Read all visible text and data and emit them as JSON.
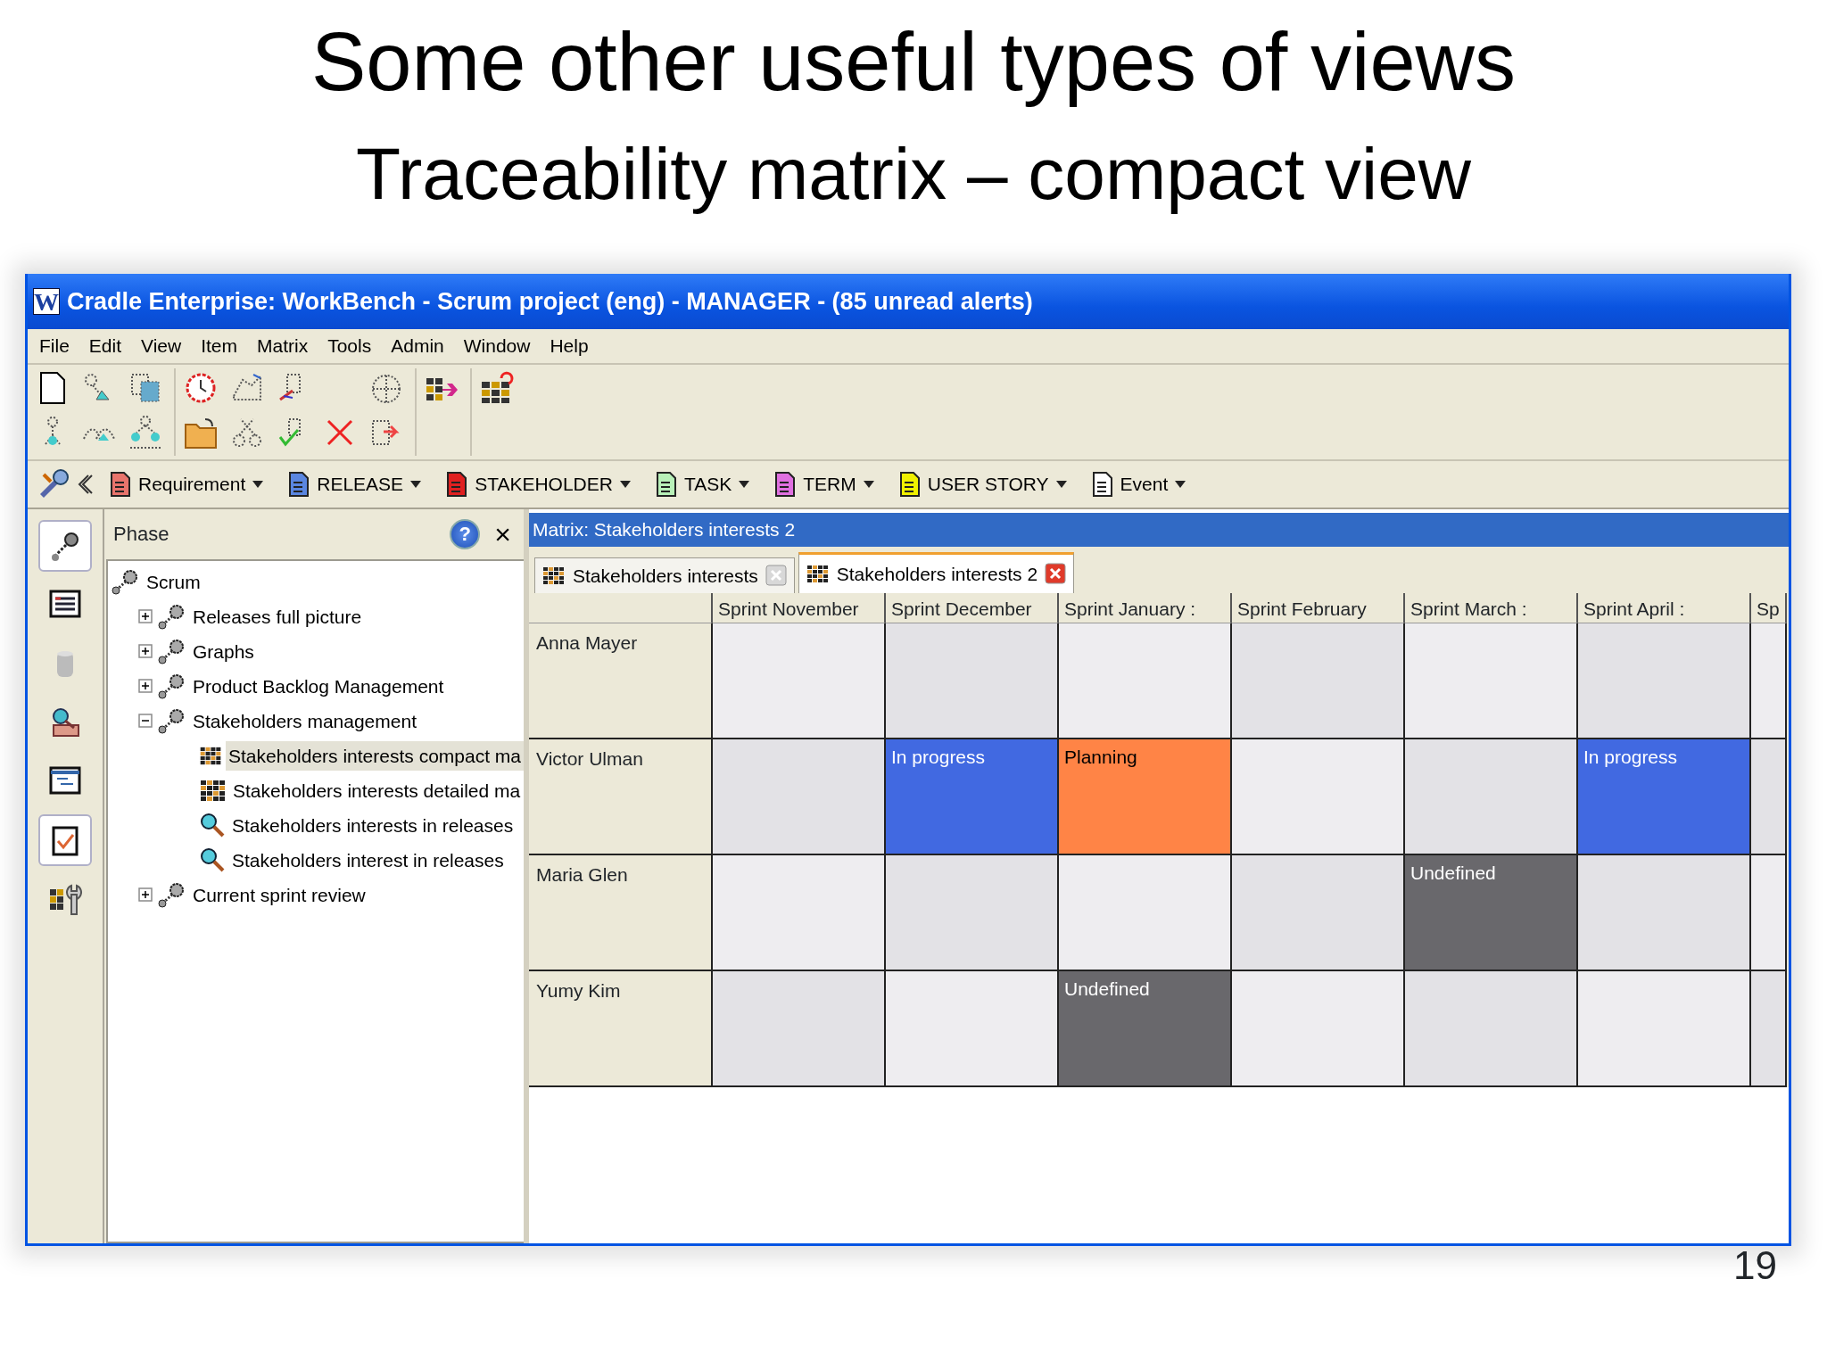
{
  "slide": {
    "title": "Some other useful types of views",
    "subtitle": "Traceability matrix – compact view",
    "page_number": "19"
  },
  "window": {
    "icon_letter": "W",
    "title": "Cradle Enterprise: WorkBench - Scrum project (eng) - MANAGER - (85 unread alerts)"
  },
  "menu": [
    "File",
    "Edit",
    "View",
    "Item",
    "Matrix",
    "Tools",
    "Admin",
    "Window",
    "Help"
  ],
  "type_toolbar": [
    {
      "label": "Requirement",
      "color": "#e8746c"
    },
    {
      "label": "RELEASE",
      "color": "#5a86e0"
    },
    {
      "label": "STAKEHOLDER",
      "color": "#e02020"
    },
    {
      "label": "TASK",
      "color": "#b8f0b8"
    },
    {
      "label": "TERM",
      "color": "#e070e0"
    },
    {
      "label": "USER STORY",
      "color": "#f0f000"
    },
    {
      "label": "Event",
      "color": "#ffffff"
    }
  ],
  "side_tools": [
    {
      "selected": true
    },
    {
      "selected": false
    },
    {
      "selected": false
    },
    {
      "selected": false
    },
    {
      "selected": false
    },
    {
      "selected": true
    },
    {
      "selected": false
    }
  ],
  "tree_panel": {
    "title": "Phase",
    "help_glyph": "?",
    "close_glyph": "×",
    "tree": [
      {
        "label": "Scrum",
        "kind": "group",
        "selected": false,
        "children": [
          {
            "label": "Releases full picture",
            "kind": "group",
            "expanded": false,
            "selected": false
          },
          {
            "label": "Graphs",
            "kind": "group",
            "expanded": false,
            "selected": false
          },
          {
            "label": "Product Backlog Management",
            "kind": "group",
            "expanded": false,
            "selected": false
          },
          {
            "label": "Stakeholders management",
            "kind": "group",
            "expanded": true,
            "selected": false,
            "children": [
              {
                "label": "Stakeholders interests compact ma",
                "kind": "matrix",
                "selected": true
              },
              {
                "label": "Stakeholders interests detailed ma",
                "kind": "matrix",
                "selected": false
              },
              {
                "label": "Stakeholders interests in releases",
                "kind": "query",
                "selected": false
              },
              {
                "label": "Stakeholders interest in releases",
                "kind": "query",
                "selected": false
              }
            ]
          },
          {
            "label": "Current sprint review",
            "kind": "group",
            "expanded": false,
            "selected": false
          }
        ]
      }
    ]
  },
  "matrix": {
    "title": "Matrix: Stakeholders interests 2",
    "tabs": [
      {
        "label": "Stakeholders interests",
        "selected": false
      },
      {
        "label": "Stakeholders interests 2",
        "selected": true
      }
    ],
    "columns": [
      "Sprint November",
      "Sprint December",
      "Sprint January :",
      "Sprint February",
      "Sprint March :",
      "Sprint April :",
      "Sp"
    ],
    "rows": [
      {
        "name": "Anna Mayer",
        "cells": [
          null,
          null,
          null,
          null,
          null,
          null,
          null
        ]
      },
      {
        "name": "Victor Ulman",
        "cells": [
          null,
          {
            "text": "In progress",
            "color": "#4169e1"
          },
          {
            "text": "Planning",
            "color": "#ff8446"
          },
          null,
          null,
          {
            "text": "In progress",
            "color": "#4169e1"
          },
          null
        ]
      },
      {
        "name": "Maria Glen",
        "cells": [
          null,
          null,
          null,
          null,
          {
            "text": "Undefined",
            "color": "#69686c"
          },
          null,
          null
        ]
      },
      {
        "name": "Yumy Kim",
        "cells": [
          null,
          null,
          {
            "text": "Undefined",
            "color": "#69686c"
          },
          null,
          null,
          null,
          null
        ]
      }
    ]
  }
}
